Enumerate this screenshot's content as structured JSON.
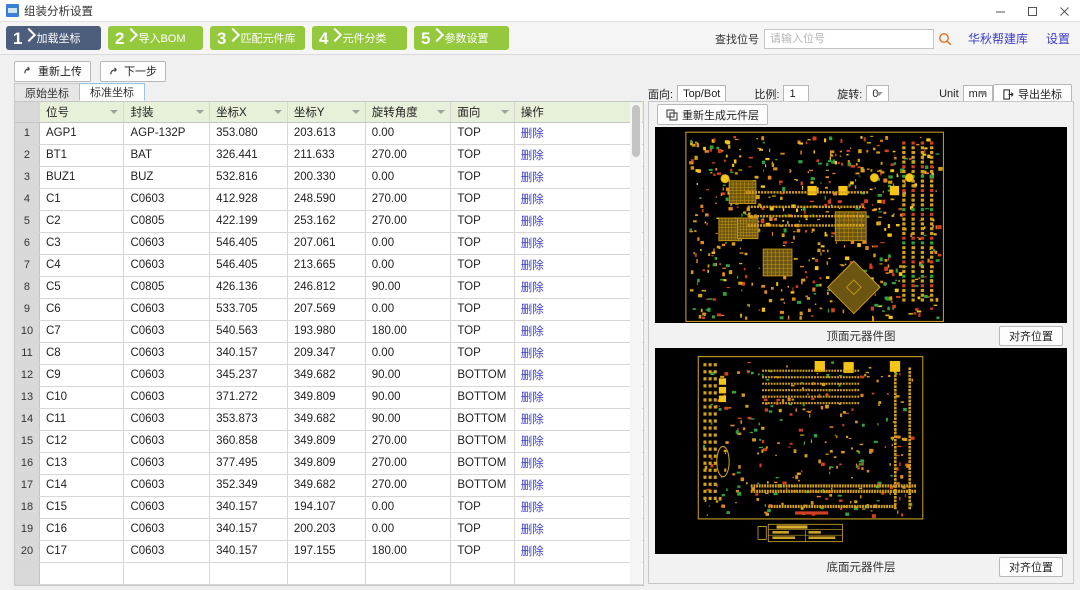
{
  "window": {
    "title": "组装分析设置",
    "icon": "app-icon",
    "minimize": "−",
    "maximize": "□",
    "close": "✕"
  },
  "steps": [
    {
      "num": "1",
      "label": "加载坐标",
      "active": true
    },
    {
      "num": "2",
      "label": "导入BOM",
      "active": false
    },
    {
      "num": "3",
      "label": "匹配元件库",
      "active": false
    },
    {
      "num": "4",
      "label": "元件分类",
      "active": false
    },
    {
      "num": "5",
      "label": "参数设置",
      "active": false
    }
  ],
  "search": {
    "label": "查找位号",
    "placeholder": "请输入位号",
    "value": "",
    "icon": "search-icon",
    "brand_link": "华秋帮建库",
    "settings_link": "设置"
  },
  "actions": {
    "reupload": "重新上传",
    "next": "下一步"
  },
  "tabs": [
    {
      "label": "原始坐标",
      "active": false
    },
    {
      "label": "标准坐标",
      "active": true
    }
  ],
  "table": {
    "columns": [
      "位号",
      "封装",
      "坐标X",
      "坐标Y",
      "旋转角度",
      "面向",
      "操作"
    ],
    "delete_label": "删除",
    "rows": [
      {
        "n": "1",
        "sym": "AGP1",
        "pkg": "AGP-132P",
        "x": "353.080",
        "y": "203.613",
        "rot": "0.00",
        "side": "TOP"
      },
      {
        "n": "2",
        "sym": "BT1",
        "pkg": "BAT",
        "x": "326.441",
        "y": "211.633",
        "rot": "270.00",
        "side": "TOP"
      },
      {
        "n": "3",
        "sym": "BUZ1",
        "pkg": "BUZ",
        "x": "532.816",
        "y": "200.330",
        "rot": "0.00",
        "side": "TOP"
      },
      {
        "n": "4",
        "sym": "C1",
        "pkg": "C0603",
        "x": "412.928",
        "y": "248.590",
        "rot": "270.00",
        "side": "TOP"
      },
      {
        "n": "5",
        "sym": "C2",
        "pkg": "C0805",
        "x": "422.199",
        "y": "253.162",
        "rot": "270.00",
        "side": "TOP"
      },
      {
        "n": "6",
        "sym": "C3",
        "pkg": "C0603",
        "x": "546.405",
        "y": "207.061",
        "rot": "0.00",
        "side": "TOP"
      },
      {
        "n": "7",
        "sym": "C4",
        "pkg": "C0603",
        "x": "546.405",
        "y": "213.665",
        "rot": "0.00",
        "side": "TOP"
      },
      {
        "n": "8",
        "sym": "C5",
        "pkg": "C0805",
        "x": "426.136",
        "y": "246.812",
        "rot": "90.00",
        "side": "TOP"
      },
      {
        "n": "9",
        "sym": "C6",
        "pkg": "C0603",
        "x": "533.705",
        "y": "207.569",
        "rot": "0.00",
        "side": "TOP"
      },
      {
        "n": "10",
        "sym": "C7",
        "pkg": "C0603",
        "x": "540.563",
        "y": "193.980",
        "rot": "180.00",
        "side": "TOP"
      },
      {
        "n": "11",
        "sym": "C8",
        "pkg": "C0603",
        "x": "340.157",
        "y": "209.347",
        "rot": "0.00",
        "side": "TOP"
      },
      {
        "n": "12",
        "sym": "C9",
        "pkg": "C0603",
        "x": "345.237",
        "y": "349.682",
        "rot": "90.00",
        "side": "BOTTOM"
      },
      {
        "n": "13",
        "sym": "C10",
        "pkg": "C0603",
        "x": "371.272",
        "y": "349.809",
        "rot": "90.00",
        "side": "BOTTOM"
      },
      {
        "n": "14",
        "sym": "C11",
        "pkg": "C0603",
        "x": "353.873",
        "y": "349.682",
        "rot": "90.00",
        "side": "BOTTOM"
      },
      {
        "n": "15",
        "sym": "C12",
        "pkg": "C0603",
        "x": "360.858",
        "y": "349.809",
        "rot": "270.00",
        "side": "BOTTOM"
      },
      {
        "n": "16",
        "sym": "C13",
        "pkg": "C0603",
        "x": "377.495",
        "y": "349.809",
        "rot": "270.00",
        "side": "BOTTOM"
      },
      {
        "n": "17",
        "sym": "C14",
        "pkg": "C0603",
        "x": "352.349",
        "y": "349.682",
        "rot": "270.00",
        "side": "BOTTOM"
      },
      {
        "n": "18",
        "sym": "C15",
        "pkg": "C0603",
        "x": "340.157",
        "y": "194.107",
        "rot": "0.00",
        "side": "TOP"
      },
      {
        "n": "19",
        "sym": "C16",
        "pkg": "C0603",
        "x": "340.157",
        "y": "200.203",
        "rot": "0.00",
        "side": "TOP"
      },
      {
        "n": "20",
        "sym": "C17",
        "pkg": "C0603",
        "x": "340.157",
        "y": "197.155",
        "rot": "180.00",
        "side": "TOP"
      }
    ]
  },
  "preview_toolbar": {
    "side_label": "面向:",
    "side_value": "Top/Bot",
    "scale_label": "比例:",
    "scale_value": "1",
    "rotate_label": "旋转:",
    "rotate_value": "0",
    "unit_label": "Unit",
    "unit_value": "mm",
    "export_label": "导出坐标"
  },
  "preview": {
    "regen_label": "重新生成元件层",
    "top_caption": "顶面元器件图",
    "bottom_caption": "底面元器件层",
    "align_label": "对齐位置"
  },
  "colors": {
    "step_active": "#4d5d7c",
    "step_green": "#95c93d",
    "link_blue": "#3c3cc8",
    "header_green": "#e7f1da",
    "pcb_background": "#000000",
    "pcb_outline": "#d4a017",
    "pcb_pad_red": "#d04020",
    "pcb_pad_green": "#30a040",
    "pcb_pad_yellow": "#f5c518"
  }
}
